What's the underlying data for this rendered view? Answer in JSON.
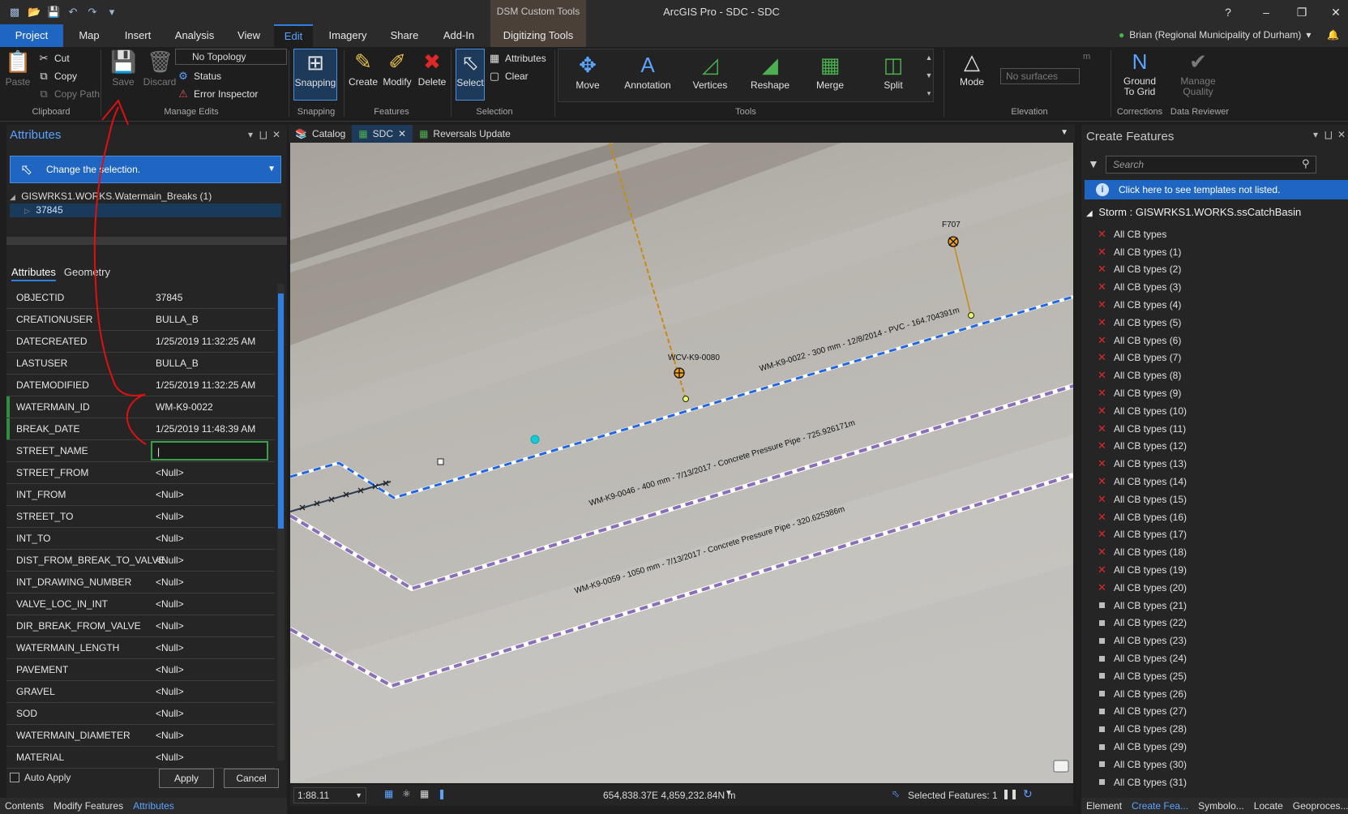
{
  "titlebar": {
    "app_title": "ArcGIS Pro - SDC - SDC",
    "context_tab_group": "DSM Custom Tools",
    "help": "?",
    "minimize": "–",
    "restore": "❐",
    "close": "✕"
  },
  "tabs": [
    "Project",
    "Map",
    "Insert",
    "Analysis",
    "View",
    "Edit",
    "Imagery",
    "Share",
    "Add-In",
    "Digitizing Tools"
  ],
  "user": {
    "name": "Brian (Regional Municipality of Durham)"
  },
  "ribbon": {
    "clipboard": {
      "paste": "Paste",
      "cut": "Cut",
      "copy": "Copy",
      "copy_path": "Copy Path",
      "label": "Clipboard"
    },
    "manage_edits": {
      "save": "Save",
      "discard": "Discard",
      "topology": "No Topology",
      "status": "Status",
      "error_inspector": "Error Inspector",
      "label": "Manage Edits"
    },
    "snapping": {
      "snapping": "Snapping",
      "label": "Snapping"
    },
    "features": {
      "create": "Create",
      "modify": "Modify",
      "delete": "Delete",
      "label": "Features"
    },
    "selection": {
      "select": "Select",
      "attributes": "Attributes",
      "clear": "Clear",
      "label": "Selection"
    },
    "tools": {
      "move": "Move",
      "annotation": "Annotation",
      "vertices": "Vertices",
      "reshape": "Reshape",
      "merge": "Merge",
      "split": "Split",
      "label": "Tools"
    },
    "elevation": {
      "mode": "Mode",
      "surfaces": "No surfaces",
      "unit": "m",
      "label": "Elevation"
    },
    "corrections": {
      "ground_to_grid": "Ground To Grid",
      "label": "Corrections"
    },
    "data_reviewer": {
      "manage_quality": "Manage Quality",
      "label": "Data Reviewer"
    }
  },
  "attributes_pane": {
    "title": "Attributes",
    "selection_prompt": "Change the selection.",
    "layer": "GISWRKS1.WORKS.Watermain_Breaks (1)",
    "feature": "37845",
    "tabs": [
      "Attributes",
      "Geometry"
    ],
    "rows": [
      {
        "name": "OBJECTID",
        "value": "37845",
        "required": false
      },
      {
        "name": "CREATIONUSER",
        "value": "BULLA_B",
        "required": false
      },
      {
        "name": "DATECREATED",
        "value": "1/25/2019 11:32:25 AM",
        "required": false
      },
      {
        "name": "LASTUSER",
        "value": "BULLA_B",
        "required": false
      },
      {
        "name": "DATEMODIFIED",
        "value": "1/25/2019 11:32:25 AM",
        "required": false
      },
      {
        "name": "WATERMAIN_ID",
        "value": "WM-K9-0022",
        "required": true
      },
      {
        "name": "BREAK_DATE",
        "value": "1/25/2019 11:48:39 AM",
        "required": true
      },
      {
        "name": "STREET_NAME",
        "value": "|",
        "required": false,
        "editing": true
      },
      {
        "name": "STREET_FROM",
        "value": "<Null>",
        "required": false
      },
      {
        "name": "INT_FROM",
        "value": "<Null>",
        "required": false
      },
      {
        "name": "STREET_TO",
        "value": "<Null>",
        "required": false
      },
      {
        "name": "INT_TO",
        "value": "<Null>",
        "required": false
      },
      {
        "name": "DIST_FROM_BREAK_TO_VALVE",
        "value": "<Null>",
        "required": false
      },
      {
        "name": "INT_DRAWING_NUMBER",
        "value": "<Null>",
        "required": false
      },
      {
        "name": "VALVE_LOC_IN_INT",
        "value": "<Null>",
        "required": false
      },
      {
        "name": "DIR_BREAK_FROM_VALVE",
        "value": "<Null>",
        "required": false
      },
      {
        "name": "WATERMAIN_LENGTH",
        "value": "<Null>",
        "required": false
      },
      {
        "name": "PAVEMENT",
        "value": "<Null>",
        "required": false
      },
      {
        "name": "GRAVEL",
        "value": "<Null>",
        "required": false
      },
      {
        "name": "SOD",
        "value": "<Null>",
        "required": false
      },
      {
        "name": "WATERMAIN_DIAMETER",
        "value": "<Null>",
        "required": false
      },
      {
        "name": "MATERIAL",
        "value": "<Null>",
        "required": false
      }
    ],
    "auto_apply": "Auto Apply",
    "apply": "Apply",
    "cancel": "Cancel"
  },
  "left_bottom_tabs": [
    "Contents",
    "Modify Features",
    "Attributes"
  ],
  "map_tabs": [
    "Catalog",
    "SDC",
    "Reversals Update"
  ],
  "map": {
    "labels": {
      "wm22": "WM-K9-0022 - 300 mm - 12/8/2014 - PVC - 164.704391m",
      "wm46": "WM-K9-0046 - 400 mm - 7/13/2017 - Concrete Pressure Pipe - 725.926171m",
      "wm59": "WM-K9-0059 - 1050 mm - 7/13/2017 - Concrete Pressure Pipe - 320.625386m",
      "valve": "WCV-K9-0080",
      "hydrant": "F707"
    },
    "scale": "1:88.11",
    "coordinates": "654,838.37E 4,859,232.84N m",
    "selected_features": "Selected Features: 1"
  },
  "create_features": {
    "title": "Create Features",
    "search_placeholder": "Search",
    "info": "Click here to see templates not listed.",
    "group": "Storm : GISWRKS1.WORKS.ssCatchBasin",
    "items": [
      {
        "label": "All CB types",
        "invalid": true
      },
      {
        "label": "All CB types (1)",
        "invalid": true
      },
      {
        "label": "All CB types (2)",
        "invalid": true
      },
      {
        "label": "All CB types (3)",
        "invalid": true
      },
      {
        "label": "All CB types (4)",
        "invalid": true
      },
      {
        "label": "All CB types (5)",
        "invalid": true
      },
      {
        "label": "All CB types (6)",
        "invalid": true
      },
      {
        "label": "All CB types (7)",
        "invalid": true
      },
      {
        "label": "All CB types (8)",
        "invalid": true
      },
      {
        "label": "All CB types (9)",
        "invalid": true
      },
      {
        "label": "All CB types (10)",
        "invalid": true
      },
      {
        "label": "All CB types (11)",
        "invalid": true
      },
      {
        "label": "All CB types (12)",
        "invalid": true
      },
      {
        "label": "All CB types (13)",
        "invalid": true
      },
      {
        "label": "All CB types (14)",
        "invalid": true
      },
      {
        "label": "All CB types (15)",
        "invalid": true
      },
      {
        "label": "All CB types (16)",
        "invalid": true
      },
      {
        "label": "All CB types (17)",
        "invalid": true
      },
      {
        "label": "All CB types (18)",
        "invalid": true
      },
      {
        "label": "All CB types (19)",
        "invalid": true
      },
      {
        "label": "All CB types (20)",
        "invalid": true
      },
      {
        "label": "All CB types (21)",
        "invalid": false
      },
      {
        "label": "All CB types (22)",
        "invalid": false
      },
      {
        "label": "All CB types (23)",
        "invalid": false
      },
      {
        "label": "All CB types (24)",
        "invalid": false
      },
      {
        "label": "All CB types (25)",
        "invalid": false
      },
      {
        "label": "All CB types (26)",
        "invalid": false
      },
      {
        "label": "All CB types (27)",
        "invalid": false
      },
      {
        "label": "All CB types (28)",
        "invalid": false
      },
      {
        "label": "All CB types (29)",
        "invalid": false
      },
      {
        "label": "All CB types (30)",
        "invalid": false
      },
      {
        "label": "All CB types (31)",
        "invalid": false
      }
    ]
  },
  "right_bottom_tabs": [
    "Element",
    "Create Fea...",
    "Symbolo...",
    "Locate",
    "Geoproces..."
  ],
  "colors": {
    "accent": "#1f66c3",
    "edit_tab": "#5aa3ff",
    "required": "#2f8f3f",
    "invalid": "#e02828",
    "annotation": "#e01010"
  }
}
